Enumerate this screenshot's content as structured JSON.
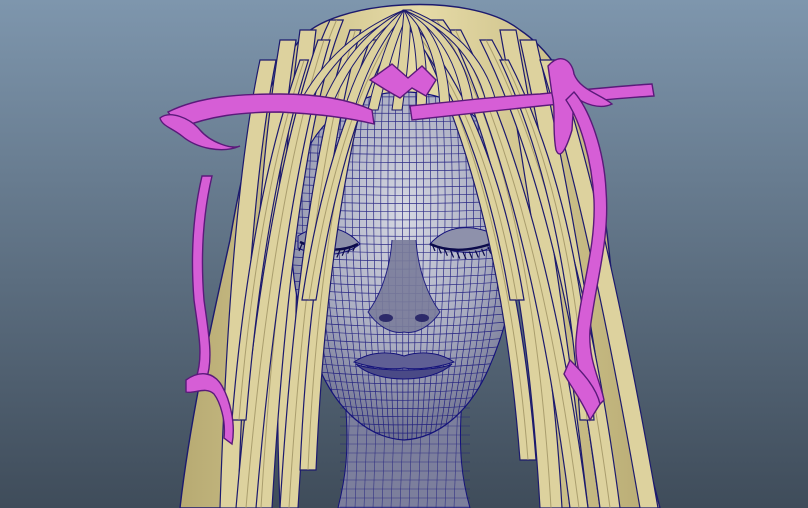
{
  "viewport": {
    "background_top": "#7e96ad",
    "background_bottom": "#3f4c5a"
  },
  "model": {
    "skin_color": "#c8cad6",
    "skin_shadow": "#6f7290",
    "wire_color": "#14127a",
    "hair_color": "#ddd29e",
    "hair_shadow": "#9d9162",
    "hair_edge": "#1c1a6e",
    "ribbon_color": "#d65ed6",
    "ribbon_edge": "#5a1a7a"
  }
}
